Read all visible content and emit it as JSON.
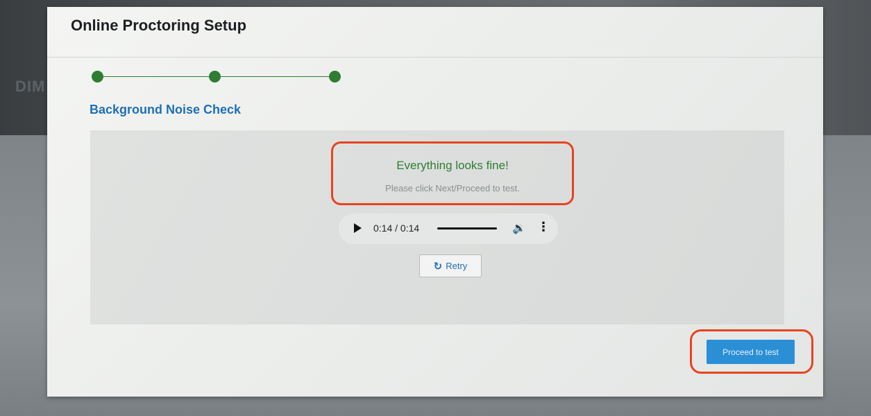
{
  "background": {
    "partial_text": "DIM"
  },
  "modal": {
    "title": "Online Proctoring Setup"
  },
  "stepper": {
    "steps": 3,
    "color": "#2e7d32"
  },
  "section": {
    "title": "Background Noise Check"
  },
  "status": {
    "title": "Everything looks fine!",
    "subtitle": "Please click Next/Proceed to test.",
    "color": "#2e7d32"
  },
  "audio": {
    "time": "0:14 / 0:14",
    "progress": 1.0,
    "play_icon": "play-icon",
    "volume_icon": "volume-icon",
    "more_icon": "more-vertical-icon"
  },
  "retry": {
    "icon": "refresh-icon",
    "label": "Retry"
  },
  "proceed": {
    "label": "Proceed to test",
    "color": "#2b8fd6"
  },
  "annotation": {
    "color": "#e8431f"
  }
}
